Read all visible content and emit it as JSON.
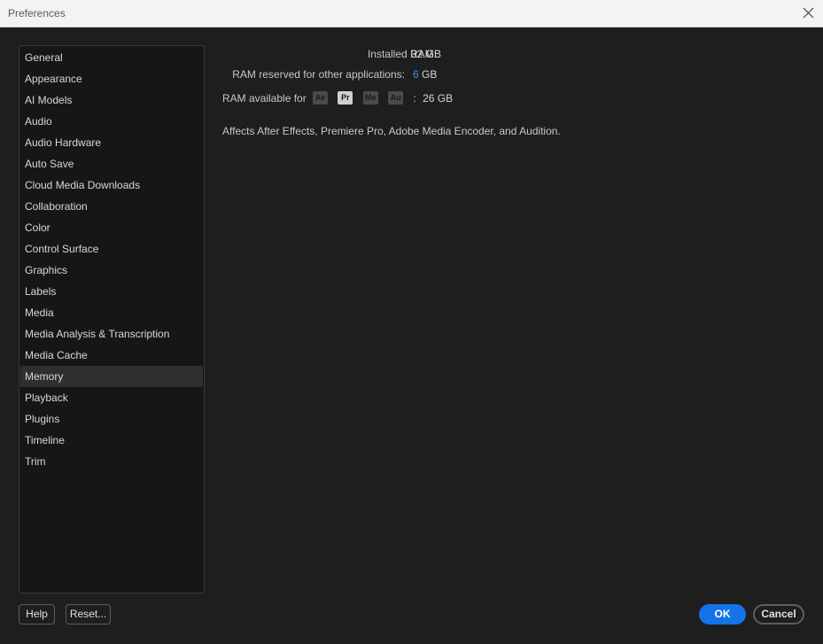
{
  "window": {
    "title": "Preferences"
  },
  "sidebar": {
    "items": [
      {
        "label": "General"
      },
      {
        "label": "Appearance"
      },
      {
        "label": "AI Models"
      },
      {
        "label": "Audio"
      },
      {
        "label": "Audio Hardware"
      },
      {
        "label": "Auto Save"
      },
      {
        "label": "Cloud Media Downloads"
      },
      {
        "label": "Collaboration"
      },
      {
        "label": "Color"
      },
      {
        "label": "Control Surface"
      },
      {
        "label": "Graphics"
      },
      {
        "label": "Labels"
      },
      {
        "label": "Media"
      },
      {
        "label": "Media Analysis & Transcription"
      },
      {
        "label": "Media Cache"
      },
      {
        "label": "Memory"
      },
      {
        "label": "Playback"
      },
      {
        "label": "Plugins"
      },
      {
        "label": "Timeline"
      },
      {
        "label": "Trim"
      }
    ],
    "selected": "Memory"
  },
  "memory": {
    "installed_label": "Installed RAM:",
    "installed_value": "32 GB",
    "reserved_label": "RAM reserved for other applications:",
    "reserved_value": "6",
    "reserved_unit": "GB",
    "available_label": "RAM available for",
    "apps": [
      {
        "abbr": "Ae",
        "active": false
      },
      {
        "abbr": "Pr",
        "active": true
      },
      {
        "abbr": "Me",
        "active": false
      },
      {
        "abbr": "Au",
        "active": false
      }
    ],
    "colon": ":",
    "available_value": "26 GB",
    "note": "Affects After Effects, Premiere Pro, Adobe Media Encoder, and Audition."
  },
  "footer": {
    "help_label": "Help",
    "reset_label": "Reset...",
    "ok_label": "OK",
    "cancel_label": "Cancel"
  },
  "colors": {
    "accent": "#1473e6",
    "link_blue": "#3d8ff0",
    "background": "#1e1e1e",
    "sidebar_bg": "#161616",
    "selected_bg": "#2f2f2f"
  }
}
